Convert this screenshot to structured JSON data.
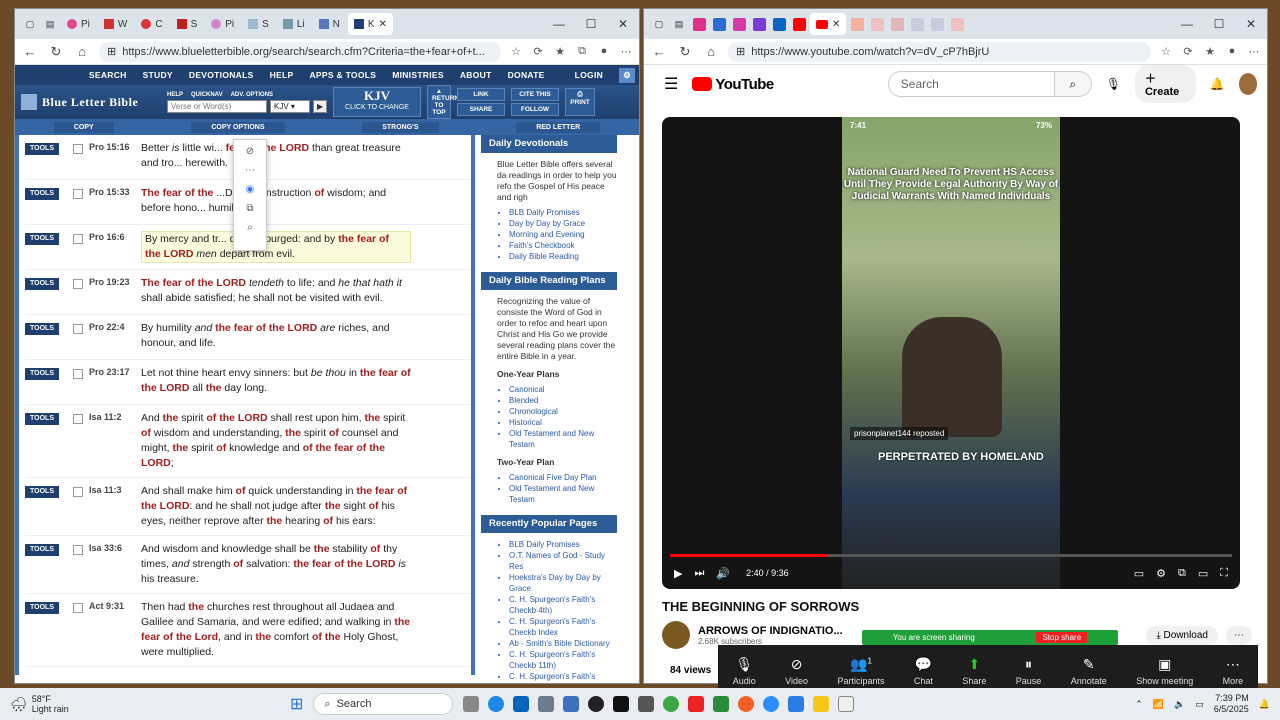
{
  "left_window": {
    "url": "https://www.blueletterbible.org/search/search.cfm?Criteria=the+fear+of+t...",
    "tabs": [
      "Pi",
      "W",
      "C",
      "S",
      "Pi",
      "S",
      "Li",
      "N",
      "K"
    ],
    "nav": [
      "SEARCH",
      "STUDY",
      "DEVOTIONALS",
      "HELP",
      "APPS & TOOLS",
      "MINISTRIES",
      "ABOUT",
      "DONATE",
      "LOGIN"
    ],
    "logo": "Blue Letter Bible",
    "search_labels": [
      "HELP",
      "QUICKNAV",
      "ADV. OPTIONS"
    ],
    "search_placeholder": "Verse or Word(s)",
    "version": "KJV",
    "kjv_big": "KJV",
    "kjv_sub": "CLICK TO CHANGE",
    "return_top": "RETURN TO TOP",
    "link": "LINK",
    "share": "SHARE",
    "cite": "CITE THIS",
    "follow": "FOLLOW",
    "print": "PRINT",
    "options": [
      "COPY",
      "COPY OPTIONS",
      "STRONG'S",
      "RED LETTER"
    ],
    "tools_label": "TOOLS",
    "verses": [
      {
        "ref": "Pro 15:16",
        "html": "Better <i>is</i> little wi... <span class=\"h\">fear of the LORD</span> than great treasure and tro... herewith."
      },
      {
        "ref": "Pro 15:33",
        "html": "<span class=\"h\">The fear of the</span> ...D <i>is</i> the instruction <span class=\"h\">of</span> wisdom; and before hono... humility."
      },
      {
        "ref": "Pro 16:6",
        "html": "By mercy and tr... quity is purged: and by <span class=\"h\">the fear of the LORD</span> <i>men</i> depart from evil."
      },
      {
        "ref": "Pro 19:23",
        "html": "<span class=\"h\">The fear of the LORD</span> <i>tendeth</i> to life: and <i>he that hath it</i> shall abide satisfied; he shall not be visited with evil."
      },
      {
        "ref": "Pro 22:4",
        "html": "By humility <i>and</i> <span class=\"h\">the fear of the LORD</span> <i>are</i> riches, and honour, and life."
      },
      {
        "ref": "Pro 23:17",
        "html": "Let not thine heart envy sinners: but <i>be thou</i> in <span class=\"h\">the fear of the LORD</span> all <span class=\"h\">the</span> day long."
      },
      {
        "ref": "Isa 11:2",
        "html": "And <span class=\"h\">the</span> spirit <span class=\"h\">of the LORD</span> shall rest upon him, <span class=\"h\">the</span> spirit <span class=\"h\">of</span> wisdom and understanding, <span class=\"h\">the</span> spirit <span class=\"h\">of</span> counsel and might, <span class=\"h\">the</span> spirit <span class=\"h\">of</span> knowledge and <span class=\"h\">of the fear of the LORD</span>;"
      },
      {
        "ref": "Isa 11:3",
        "html": "And shall make him <span class=\"h\">of</span> quick understanding in <span class=\"h\">the fear of the LORD</span>: and he shall not judge after <span class=\"h\">the</span> sight <span class=\"h\">of</span> his eyes, neither reprove after <span class=\"h\">the</span> hearing <span class=\"h\">of</span> his ears:"
      },
      {
        "ref": "Isa 33:6",
        "html": "And wisdom and knowledge shall be <span class=\"h\">the</span> stability <span class=\"h\">of</span> thy times, <i>and</i> strength <span class=\"h\">of</span> salvation: <span class=\"h\">the fear of the LORD</span> <i>is</i> his treasure."
      },
      {
        "ref": "Act 9:31",
        "html": "Then had <span class=\"h\">the</span> churches rest throughout all Judaea and Galilee and Samaria, and were edified; and walking in <span class=\"h\">the fear of the Lord</span>, and in <span class=\"h\">the</span> comfort <span class=\"h\">of the</span> Holy Ghost, were multiplied."
      }
    ],
    "sidebar": {
      "dev_title": "Daily Devotionals",
      "dev_text": "Blue Letter Bible offers several da readings in order to help you refo the Gospel of His peace and righ",
      "dev_links": [
        "BLB Daily Promises",
        "Day by Day by Grace",
        "Morning and Evening",
        "Faith's Checkbook",
        "Daily Bible Reading"
      ],
      "plan_title": "Daily Bible Reading Plans",
      "plan_text": "Recognizing the value of consiste the Word of God in order to refoc and heart upon Christ and His Go we provide several reading plans cover the entire Bible in a year.",
      "one_year": "One-Year Plans",
      "one_year_links": [
        "Canonical",
        "Blended",
        "Chronological",
        "Historical",
        "Old Testament and New Testam"
      ],
      "two_year": "Two-Year Plan",
      "two_year_links": [
        "Canonical Five Day Plan",
        "Old Testament and New Testam"
      ],
      "pop_title": "Recently Popular Pages",
      "pop_links": [
        "BLB Daily Promises",
        "O.T. Names of God - Study Res",
        "Hoekstra's Day by Day by Grace",
        "C. H. Spurgeon's Faith's Checkb 4th)",
        "C. H. Spurgeon's Faith's Checkb Index",
        "Ab - Smith's Bible Dictionary",
        "C. H. Spurgeon's Faith's Checkb 11th)",
        "C. H. Spurgeon's Faith's Checkb (February 12th)",
        "C. H. Spurgeon's Faith's Checkb 30th)",
        "C. H. Spurgeon's Faith's Checkb"
      ]
    }
  },
  "right_window": {
    "url": "https://www.youtube.com/watch?v=dV_cP7hBjrU",
    "search_placeholder": "Search",
    "create": "Create",
    "logo_text": "YouTube",
    "video_overlay": "National Guard Need To Prevent HS Access Until They Provide Legal Authority By Way of Judicial Warrants With Named Individuals",
    "phone_time": "7:41",
    "phone_battery": "73%",
    "reposted": "prisonplanet144 reposted",
    "caption_big": "PERPETRATED BY HOMELAND",
    "time": "2:40 / 9:36",
    "progress_fraction": 0.28,
    "title": "THE BEGINNING OF SORROWS",
    "channel": "ARROWS OF INDIGNATIO...",
    "subs": "2.68K subscribers",
    "download": "Download",
    "views": "84 views",
    "screen_sharing": "You are screen sharing",
    "stop_share": "Stop share",
    "zoom_buttons": [
      "Audio",
      "Video",
      "Participants",
      "Chat",
      "Share",
      "Pause",
      "Annotate",
      "Show meeting",
      "More"
    ],
    "participants_count": "1"
  },
  "taskbar": {
    "temp": "58°F",
    "weather": "Light rain",
    "search": "Search",
    "time": "7:39 PM",
    "date": "6/5/2025"
  }
}
